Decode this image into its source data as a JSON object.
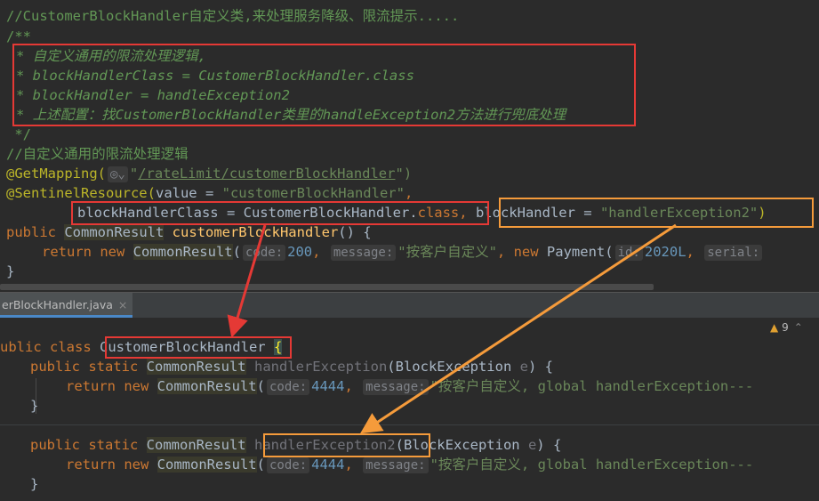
{
  "code_top": {
    "l1": "//CustomerBlockHandler自定义类,来处理服务降级、限流提示.....",
    "l2": "/**",
    "l3": "* 自定义通用的限流处理逻辑,",
    "l4": "* blockHandlerClass = CustomerBlockHandler.class",
    "l5": "* blockHandler = handleException2",
    "l6": "* 上述配置：找CustomerBlockHandler类里的handleException2方法进行兜底处理",
    "l7": " */",
    "l8": "//自定义通用的限流处理逻辑",
    "get_ann": "@GetMapping(",
    "get_url_q1": "\"",
    "get_url": "/rateLimit/customerBlockHandler",
    "get_url_q2": "\")",
    "sent_ann": "@SentinelResource(",
    "sent_value": "value = ",
    "sent_str": "\"customerBlockHandler\"",
    "comma": ",",
    "bhc_text": "blockHandlerClass = CustomerBlockHandler.",
    "class_kw": "class",
    "bh_text": "blockHandler = ",
    "bh_str": "\"handlerException2\"",
    "close_paren": ")",
    "public": "public ",
    "common_result": "CommonResult",
    "method_name": "customerBlockHandler",
    "method_tail": "() {",
    "return": "return ",
    "new": "new ",
    "code_hint": "code:",
    "code_val": "200",
    "msg_hint": "message:",
    "msg_val": "\"按客户自定义\"",
    "payment": "Payment(",
    "id_hint": "id:",
    "id_val": "2020L",
    "serial_hint": "serial:",
    "close_brace": "}"
  },
  "tab": {
    "label": "erBlockHandler.java",
    "close": "×"
  },
  "warnings": {
    "icon": "▲",
    "count": "9"
  },
  "code_bottom": {
    "class_decl_a": "ublic class ",
    "class_name": "CustomerBlockHandler",
    "open_brace": "{",
    "public_static": "public static ",
    "common_result": "CommonResult",
    "handler1": "handlerException",
    "handler2": "handlerException2",
    "param": "(BlockException ",
    "param_e": "e",
    "param_end": ") {",
    "return": "return ",
    "new": "new ",
    "code_hint": "code:",
    "code_val": "4444",
    "msg_hint": "message:",
    "msg_val": "\"按客户自定义, global handlerException---",
    "close_brace": "}"
  }
}
